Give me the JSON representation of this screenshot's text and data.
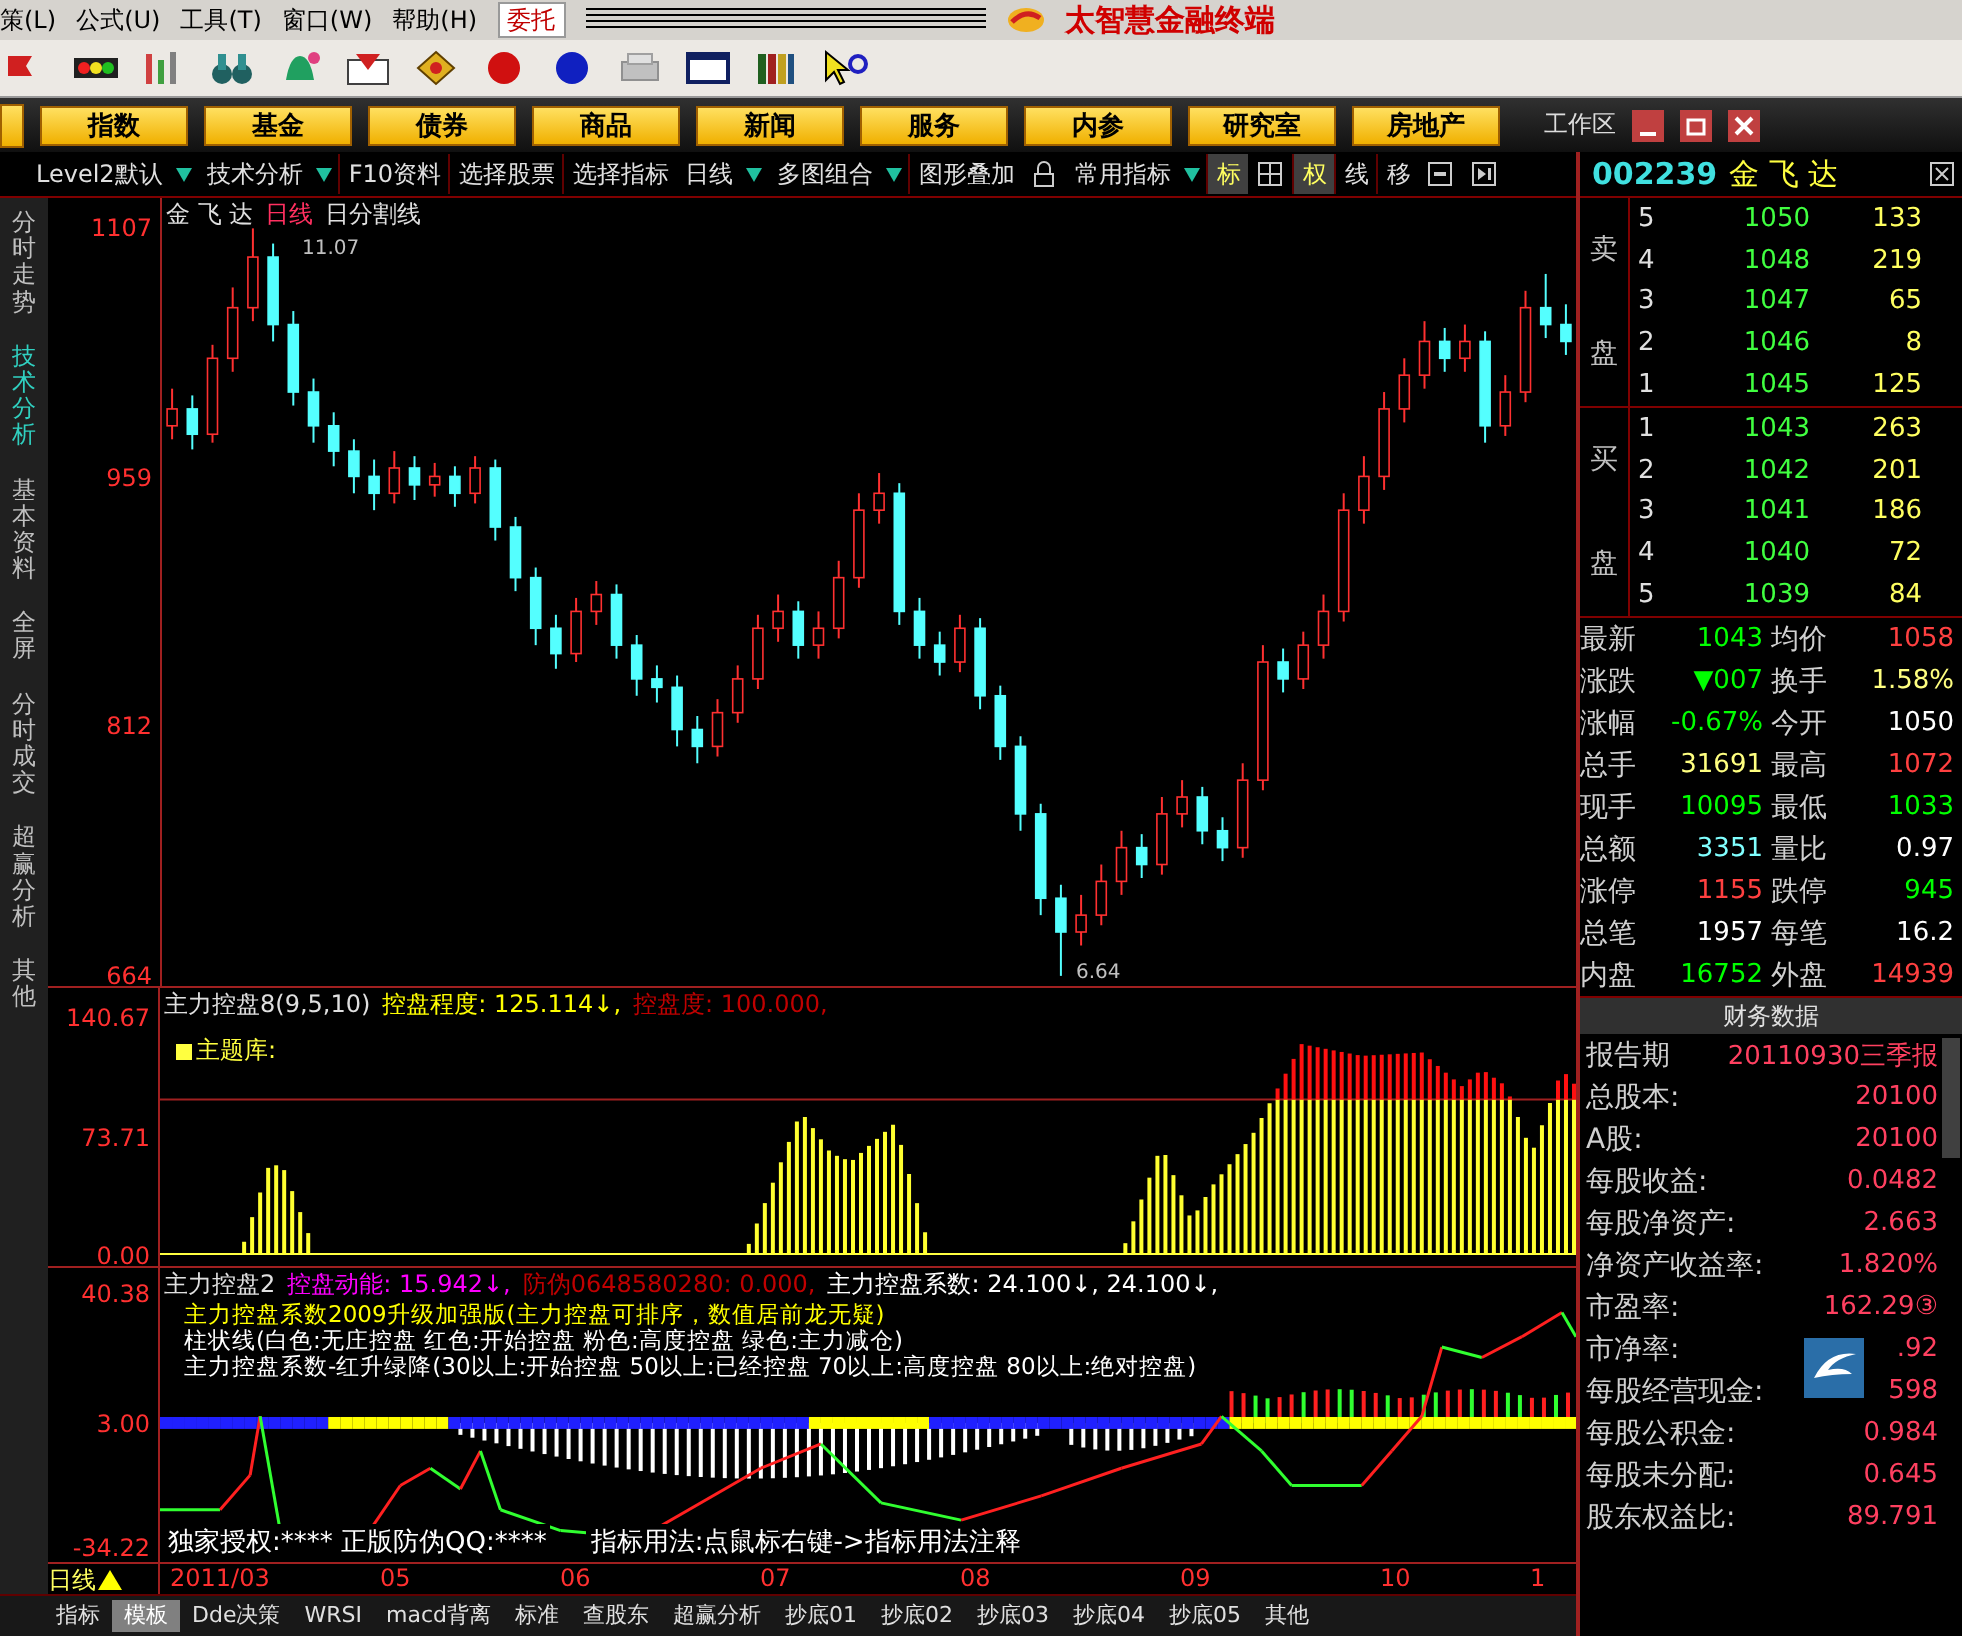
{
  "menu": {
    "items": [
      "策(L)",
      "公式(U)",
      "工具(T)",
      "窗口(W)",
      "帮助(H)"
    ],
    "order_button": "委托",
    "app_title": "太智慧金融终端"
  },
  "nav_buttons": [
    "指数",
    "基金",
    "债券",
    "商品",
    "新闻",
    "服务",
    "内参",
    "研究室",
    "房地产"
  ],
  "workspace": "工作区",
  "tool_row": [
    {
      "kind": "menu",
      "label": "Level2默认"
    },
    {
      "kind": "menu",
      "label": "技术分析"
    },
    {
      "kind": "button",
      "label": "F10资料"
    },
    {
      "kind": "button",
      "label": "选择股票"
    },
    {
      "kind": "button",
      "label": "选择指标"
    },
    {
      "kind": "menu",
      "label": "日线"
    },
    {
      "kind": "menu",
      "label": "多图组合"
    },
    {
      "kind": "button",
      "label": "图形叠加"
    },
    {
      "kind": "lock"
    },
    {
      "kind": "menu",
      "label": "常用指标"
    },
    {
      "kind": "toggle",
      "label": "标",
      "on": true
    },
    {
      "kind": "grid"
    },
    {
      "kind": "toggle",
      "label": "权",
      "on": true
    },
    {
      "kind": "toggle",
      "label": "线",
      "on": false
    },
    {
      "kind": "toggle",
      "label": "移",
      "on": false
    },
    {
      "kind": "window"
    },
    {
      "kind": "next"
    }
  ],
  "stock": {
    "code": "002239",
    "name": "金 飞 达"
  },
  "side_tabs": [
    {
      "label": "分时走势",
      "selected": false
    },
    {
      "label": "技术分析",
      "selected": true
    },
    {
      "label": "基本资料",
      "selected": false
    },
    {
      "label": "全屏",
      "selected": false
    },
    {
      "label": "分时成交",
      "selected": false
    },
    {
      "label": "超赢分析",
      "selected": false
    },
    {
      "label": "其他",
      "selected": false
    }
  ],
  "main_chart": {
    "title": "金 飞 达",
    "period": "日线",
    "overlay": "日分割线",
    "high_label": "11.07",
    "low_label": "6.64",
    "chart_data": {
      "type": "candlestick",
      "ylim": [
        658,
        1125
      ],
      "yticks": [
        1107,
        959,
        812,
        664
      ],
      "ohlc": [
        [
          990,
          1012,
          982,
          1000
        ],
        [
          1000,
          1008,
          976,
          985
        ],
        [
          985,
          1038,
          980,
          1030
        ],
        [
          1030,
          1072,
          1022,
          1060
        ],
        [
          1060,
          1107,
          1052,
          1090
        ],
        [
          1090,
          1098,
          1040,
          1050
        ],
        [
          1050,
          1058,
          1002,
          1010
        ],
        [
          1010,
          1018,
          980,
          990
        ],
        [
          990,
          998,
          966,
          975
        ],
        [
          975,
          982,
          950,
          960
        ],
        [
          960,
          970,
          940,
          950
        ],
        [
          950,
          975,
          944,
          965
        ],
        [
          965,
          972,
          946,
          955
        ],
        [
          955,
          968,
          948,
          960
        ],
        [
          960,
          966,
          942,
          950
        ],
        [
          950,
          972,
          944,
          965
        ],
        [
          965,
          970,
          922,
          930
        ],
        [
          930,
          936,
          892,
          900
        ],
        [
          900,
          906,
          860,
          870
        ],
        [
          870,
          878,
          846,
          855
        ],
        [
          855,
          888,
          850,
          880
        ],
        [
          880,
          898,
          872,
          890
        ],
        [
          890,
          896,
          852,
          860
        ],
        [
          860,
          866,
          830,
          840
        ],
        [
          840,
          848,
          826,
          835
        ],
        [
          835,
          842,
          800,
          810
        ],
        [
          810,
          818,
          790,
          800
        ],
        [
          800,
          828,
          794,
          820
        ],
        [
          820,
          848,
          814,
          840
        ],
        [
          840,
          878,
          834,
          870
        ],
        [
          870,
          890,
          862,
          880
        ],
        [
          880,
          886,
          852,
          860
        ],
        [
          860,
          880,
          852,
          870
        ],
        [
          870,
          910,
          864,
          900
        ],
        [
          900,
          950,
          894,
          940
        ],
        [
          940,
          962,
          932,
          950
        ],
        [
          950,
          956,
          872,
          880
        ],
        [
          880,
          888,
          852,
          860
        ],
        [
          860,
          868,
          842,
          850
        ],
        [
          850,
          878,
          844,
          870
        ],
        [
          870,
          876,
          822,
          830
        ],
        [
          830,
          836,
          792,
          800
        ],
        [
          800,
          806,
          750,
          760
        ],
        [
          760,
          766,
          700,
          710
        ],
        [
          710,
          718,
          664,
          690
        ],
        [
          690,
          712,
          682,
          700
        ],
        [
          700,
          730,
          694,
          720
        ],
        [
          720,
          750,
          712,
          740
        ],
        [
          740,
          748,
          722,
          730
        ],
        [
          730,
          770,
          724,
          760
        ],
        [
          760,
          780,
          752,
          770
        ],
        [
          770,
          776,
          742,
          750
        ],
        [
          750,
          758,
          732,
          740
        ],
        [
          740,
          790,
          734,
          780
        ],
        [
          780,
          860,
          774,
          850
        ],
        [
          850,
          858,
          832,
          840
        ],
        [
          840,
          868,
          834,
          860
        ],
        [
          860,
          890,
          852,
          880
        ],
        [
          880,
          950,
          874,
          940
        ],
        [
          940,
          972,
          932,
          960
        ],
        [
          960,
          1010,
          952,
          1000
        ],
        [
          1000,
          1030,
          992,
          1020
        ],
        [
          1020,
          1052,
          1012,
          1040
        ],
        [
          1040,
          1048,
          1022,
          1030
        ],
        [
          1030,
          1050,
          1022,
          1040
        ],
        [
          1040,
          1046,
          980,
          990
        ],
        [
          990,
          1020,
          984,
          1010
        ],
        [
          1010,
          1070,
          1004,
          1060
        ],
        [
          1060,
          1080,
          1042,
          1050
        ],
        [
          1050,
          1062,
          1032,
          1040
        ]
      ]
    }
  },
  "indicator_1": {
    "name": "主力控盘8(9,5,10)",
    "readouts": [
      {
        "text": "控盘程度: 125.114↓,",
        "color": "#ffff00"
      },
      {
        "text": "控盘度: 100.000,",
        "color": "#c00000"
      }
    ],
    "legend": "主题库:",
    "y_labels": [
      "140.67",
      "73.71",
      "0.00"
    ]
  },
  "indicator_2": {
    "name": "主力控盘2",
    "readouts": [
      {
        "text": "控盘动能: 15.942↓,",
        "color": "#ff00ff"
      },
      {
        "text": "防伪0648580280: 0.000,",
        "color": "#c00000"
      },
      {
        "text": "主力控盘系数: 24.100↓, 24.100↓,",
        "color": "#ffffff"
      }
    ],
    "notes": [
      {
        "text": "主力控盘系数2009升级加强版(主力控盘可排序，数值居前龙无疑)",
        "color": "#ffff00"
      },
      {
        "text": "柱状线(白色:无庄控盘 红色:开始控盘 粉色:高度控盘 绿色:主力减仓)",
        "color": "#ffffff"
      },
      {
        "text": "主力控盘系数-红升绿降(30以上:开始控盘 50以上:已经控盘 70以上:高度控盘 80以上:绝对控盘)",
        "color": "#ffffff"
      }
    ],
    "footer": [
      "独家授权:****  正版防伪QQ:****",
      "指标用法:点鼠标右键->指标用法注释"
    ],
    "y_labels": [
      "40.38",
      "3.00",
      "-34.22"
    ]
  },
  "date_axis": {
    "period": "日线",
    "labels": [
      "2011/03",
      "05",
      "06",
      "07",
      "08",
      "09",
      "10",
      "1"
    ]
  },
  "bottom_tabs": [
    {
      "label": "指标",
      "selected": false
    },
    {
      "label": "模板",
      "selected": true
    },
    {
      "label": "Dde决策",
      "selected": false
    },
    {
      "label": "WRSI",
      "selected": false
    },
    {
      "label": "macd背离",
      "selected": false
    },
    {
      "label": "标准",
      "selected": false
    },
    {
      "label": "查股东",
      "selected": false
    },
    {
      "label": "超赢分析",
      "selected": false
    },
    {
      "label": "抄底01",
      "selected": false
    },
    {
      "label": "抄底02",
      "selected": false
    },
    {
      "label": "抄底03",
      "selected": false
    },
    {
      "label": "抄底04",
      "selected": false
    },
    {
      "label": "抄底05",
      "selected": false
    },
    {
      "label": "其他",
      "selected": false
    }
  ],
  "sell": {
    "label": "卖盘",
    "rows": [
      {
        "rank": "5",
        "price": "1050",
        "volume": "133"
      },
      {
        "rank": "4",
        "price": "1048",
        "volume": "219"
      },
      {
        "rank": "3",
        "price": "1047",
        "volume": "65"
      },
      {
        "rank": "2",
        "price": "1046",
        "volume": "8"
      },
      {
        "rank": "1",
        "price": "1045",
        "volume": "125"
      }
    ]
  },
  "buy": {
    "label": "买盘",
    "rows": [
      {
        "rank": "1",
        "price": "1043",
        "volume": "263"
      },
      {
        "rank": "2",
        "price": "1042",
        "volume": "201"
      },
      {
        "rank": "3",
        "price": "1041",
        "volume": "186"
      },
      {
        "rank": "4",
        "price": "1040",
        "volume": "72"
      },
      {
        "rank": "5",
        "price": "1039",
        "volume": "84"
      }
    ]
  },
  "quote": [
    {
      "cells": [
        {
          "label": "最新",
          "value": "1043",
          "color": "#00ff00"
        },
        {
          "label": "均价",
          "value": "1058",
          "color": "#ff4040"
        }
      ]
    },
    {
      "cells": [
        {
          "label": "涨跌",
          "value": "▼007",
          "color": "#00ff00"
        },
        {
          "label": "换手",
          "value": "1.58%",
          "color": "#ffff80"
        }
      ]
    },
    {
      "cells": [
        {
          "label": "涨幅",
          "value": "-0.67%",
          "color": "#00ff00"
        },
        {
          "label": "今开",
          "value": "1050",
          "color": "#ffffff"
        }
      ]
    },
    {
      "cells": [
        {
          "label": "总手",
          "value": "31691",
          "color": "#ffff80"
        },
        {
          "label": "最高",
          "value": "1072",
          "color": "#ff4040"
        }
      ]
    },
    {
      "cells": [
        {
          "label": "现手",
          "value": "10095",
          "color": "#00ff00"
        },
        {
          "label": "最低",
          "value": "1033",
          "color": "#00ff00"
        }
      ]
    },
    {
      "cells": [
        {
          "label": "总额",
          "value": "3351",
          "color": "#80ffff"
        },
        {
          "label": "量比",
          "value": "0.97",
          "color": "#ffffff"
        }
      ]
    },
    {
      "cells": [
        {
          "label": "涨停",
          "value": "1155",
          "color": "#ff4040"
        },
        {
          "label": "跌停",
          "value": "945",
          "color": "#00ff00"
        }
      ]
    },
    {
      "cells": [
        {
          "label": "总笔",
          "value": "1957",
          "color": "#ffffff"
        },
        {
          "label": "每笔",
          "value": "16.2",
          "color": "#ffffff"
        }
      ]
    },
    {
      "cells": [
        {
          "label": "内盘",
          "value": "16752",
          "color": "#00ff00"
        },
        {
          "label": "外盘",
          "value": "14939",
          "color": "#ff4040"
        }
      ]
    }
  ],
  "finance": {
    "title": "财务数据",
    "rows": [
      {
        "label": "报告期",
        "value": "20110930三季报"
      },
      {
        "label": "总股本:",
        "value": "20100"
      },
      {
        "label": "A股:",
        "value": "20100"
      },
      {
        "label": "每股收益:",
        "value": "0.0482"
      },
      {
        "label": "每股净资产:",
        "value": "2.663"
      },
      {
        "label": "净资产收益率:",
        "value": "1.820%"
      },
      {
        "label": "市盈率:",
        "value": "162.29③"
      },
      {
        "label": "市净率:",
        "value": ".92"
      },
      {
        "label": "每股经营现金:",
        "value": "598"
      },
      {
        "label": "每股公积金:",
        "value": "0.984"
      },
      {
        "label": "每股未分配:",
        "value": "0.645"
      },
      {
        "label": "股东权益比:",
        "value": "89.791"
      }
    ]
  }
}
